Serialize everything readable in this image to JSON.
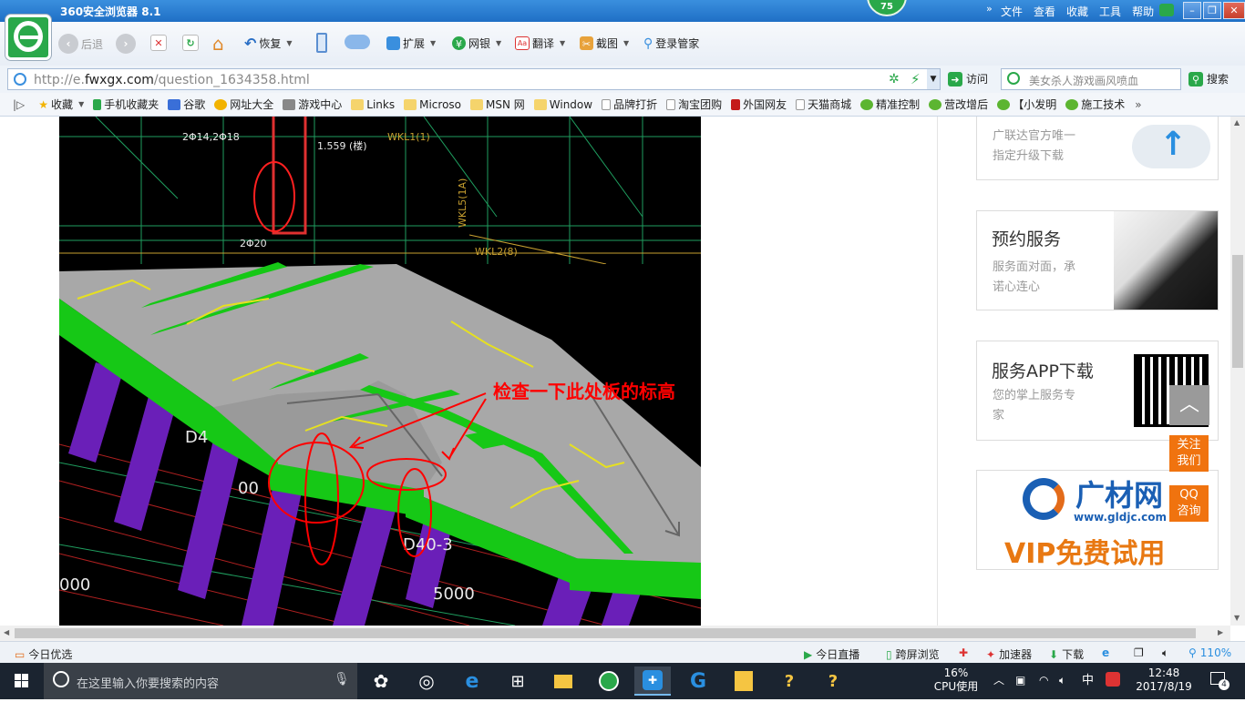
{
  "browser": {
    "title": "360安全浏览器 8.1",
    "badge": "75",
    "menu": [
      "文件",
      "查看",
      "收藏",
      "工具",
      "帮助"
    ]
  },
  "toolbar": {
    "back": "后退",
    "restore": "恢复",
    "extensions": "扩展",
    "banking": "网银",
    "translate": "翻译",
    "screenshot": "截图",
    "login_manager": "登录管家"
  },
  "address": {
    "url_prefix": "http://e.",
    "url_domain": "fwxgx.com",
    "url_path": "/question_1634358.html",
    "visit_label": "访问",
    "search_placeholder": "美女杀人游戏画风喷血",
    "search_button": "搜索"
  },
  "favorites": {
    "items": [
      "收藏",
      "手机收藏夹",
      "谷歌",
      "网址大全",
      "游戏中心",
      "Links",
      "Microso",
      "MSN 网",
      "Window",
      "品牌打折",
      "淘宝团购",
      "外国网友",
      "天猫商城",
      "精准控制",
      "营改增后",
      "【小发明",
      "施工技术"
    ]
  },
  "content": {
    "annotation": "检查一下此处板的标高",
    "cad_labels": {
      "a": "1.559 (楼)",
      "b": "WKL1(1)",
      "c": "WKL5(1A)",
      "d": "WKL2(8)",
      "e": "2Φ14,2Φ18",
      "f": "2Φ20",
      "g": "5000",
      "h": "D40-3",
      "i": "D4",
      "j": "00",
      "k": "000"
    },
    "cards": [
      {
        "title": "",
        "lines": [
          "广联达官方唯一",
          "指定升级下载"
        ]
      },
      {
        "title": "预约服务",
        "lines": [
          "服务面对面，承",
          "诺心连心"
        ]
      },
      {
        "title": "服务APP下载",
        "lines": [
          "您的掌上服务专",
          "家"
        ]
      }
    ],
    "ad": {
      "brand": "广材网",
      "site": "www.gldjc.com",
      "tagline": "VIP免费试用"
    },
    "side_buttons": [
      "关注\n我们",
      "QQ\n咨询"
    ]
  },
  "statusbar": {
    "left": "今日优选",
    "live": "今日直播",
    "cross_screen": "跨屏浏览",
    "accelerator": "加速器",
    "download": "下载",
    "zoom": "110%"
  },
  "taskbar": {
    "search_placeholder": "在这里输入你要搜索的内容",
    "cpu_percent": "16%",
    "cpu_label": "CPU使用",
    "ime": "中",
    "time": "12:48",
    "date": "2017/8/19",
    "notifications": "4"
  },
  "colors": {
    "title_blue": "#1f6fc5",
    "accent_green": "#2aa84a",
    "side_orange": "#f0730f",
    "annotation_red": "#ff0000"
  }
}
